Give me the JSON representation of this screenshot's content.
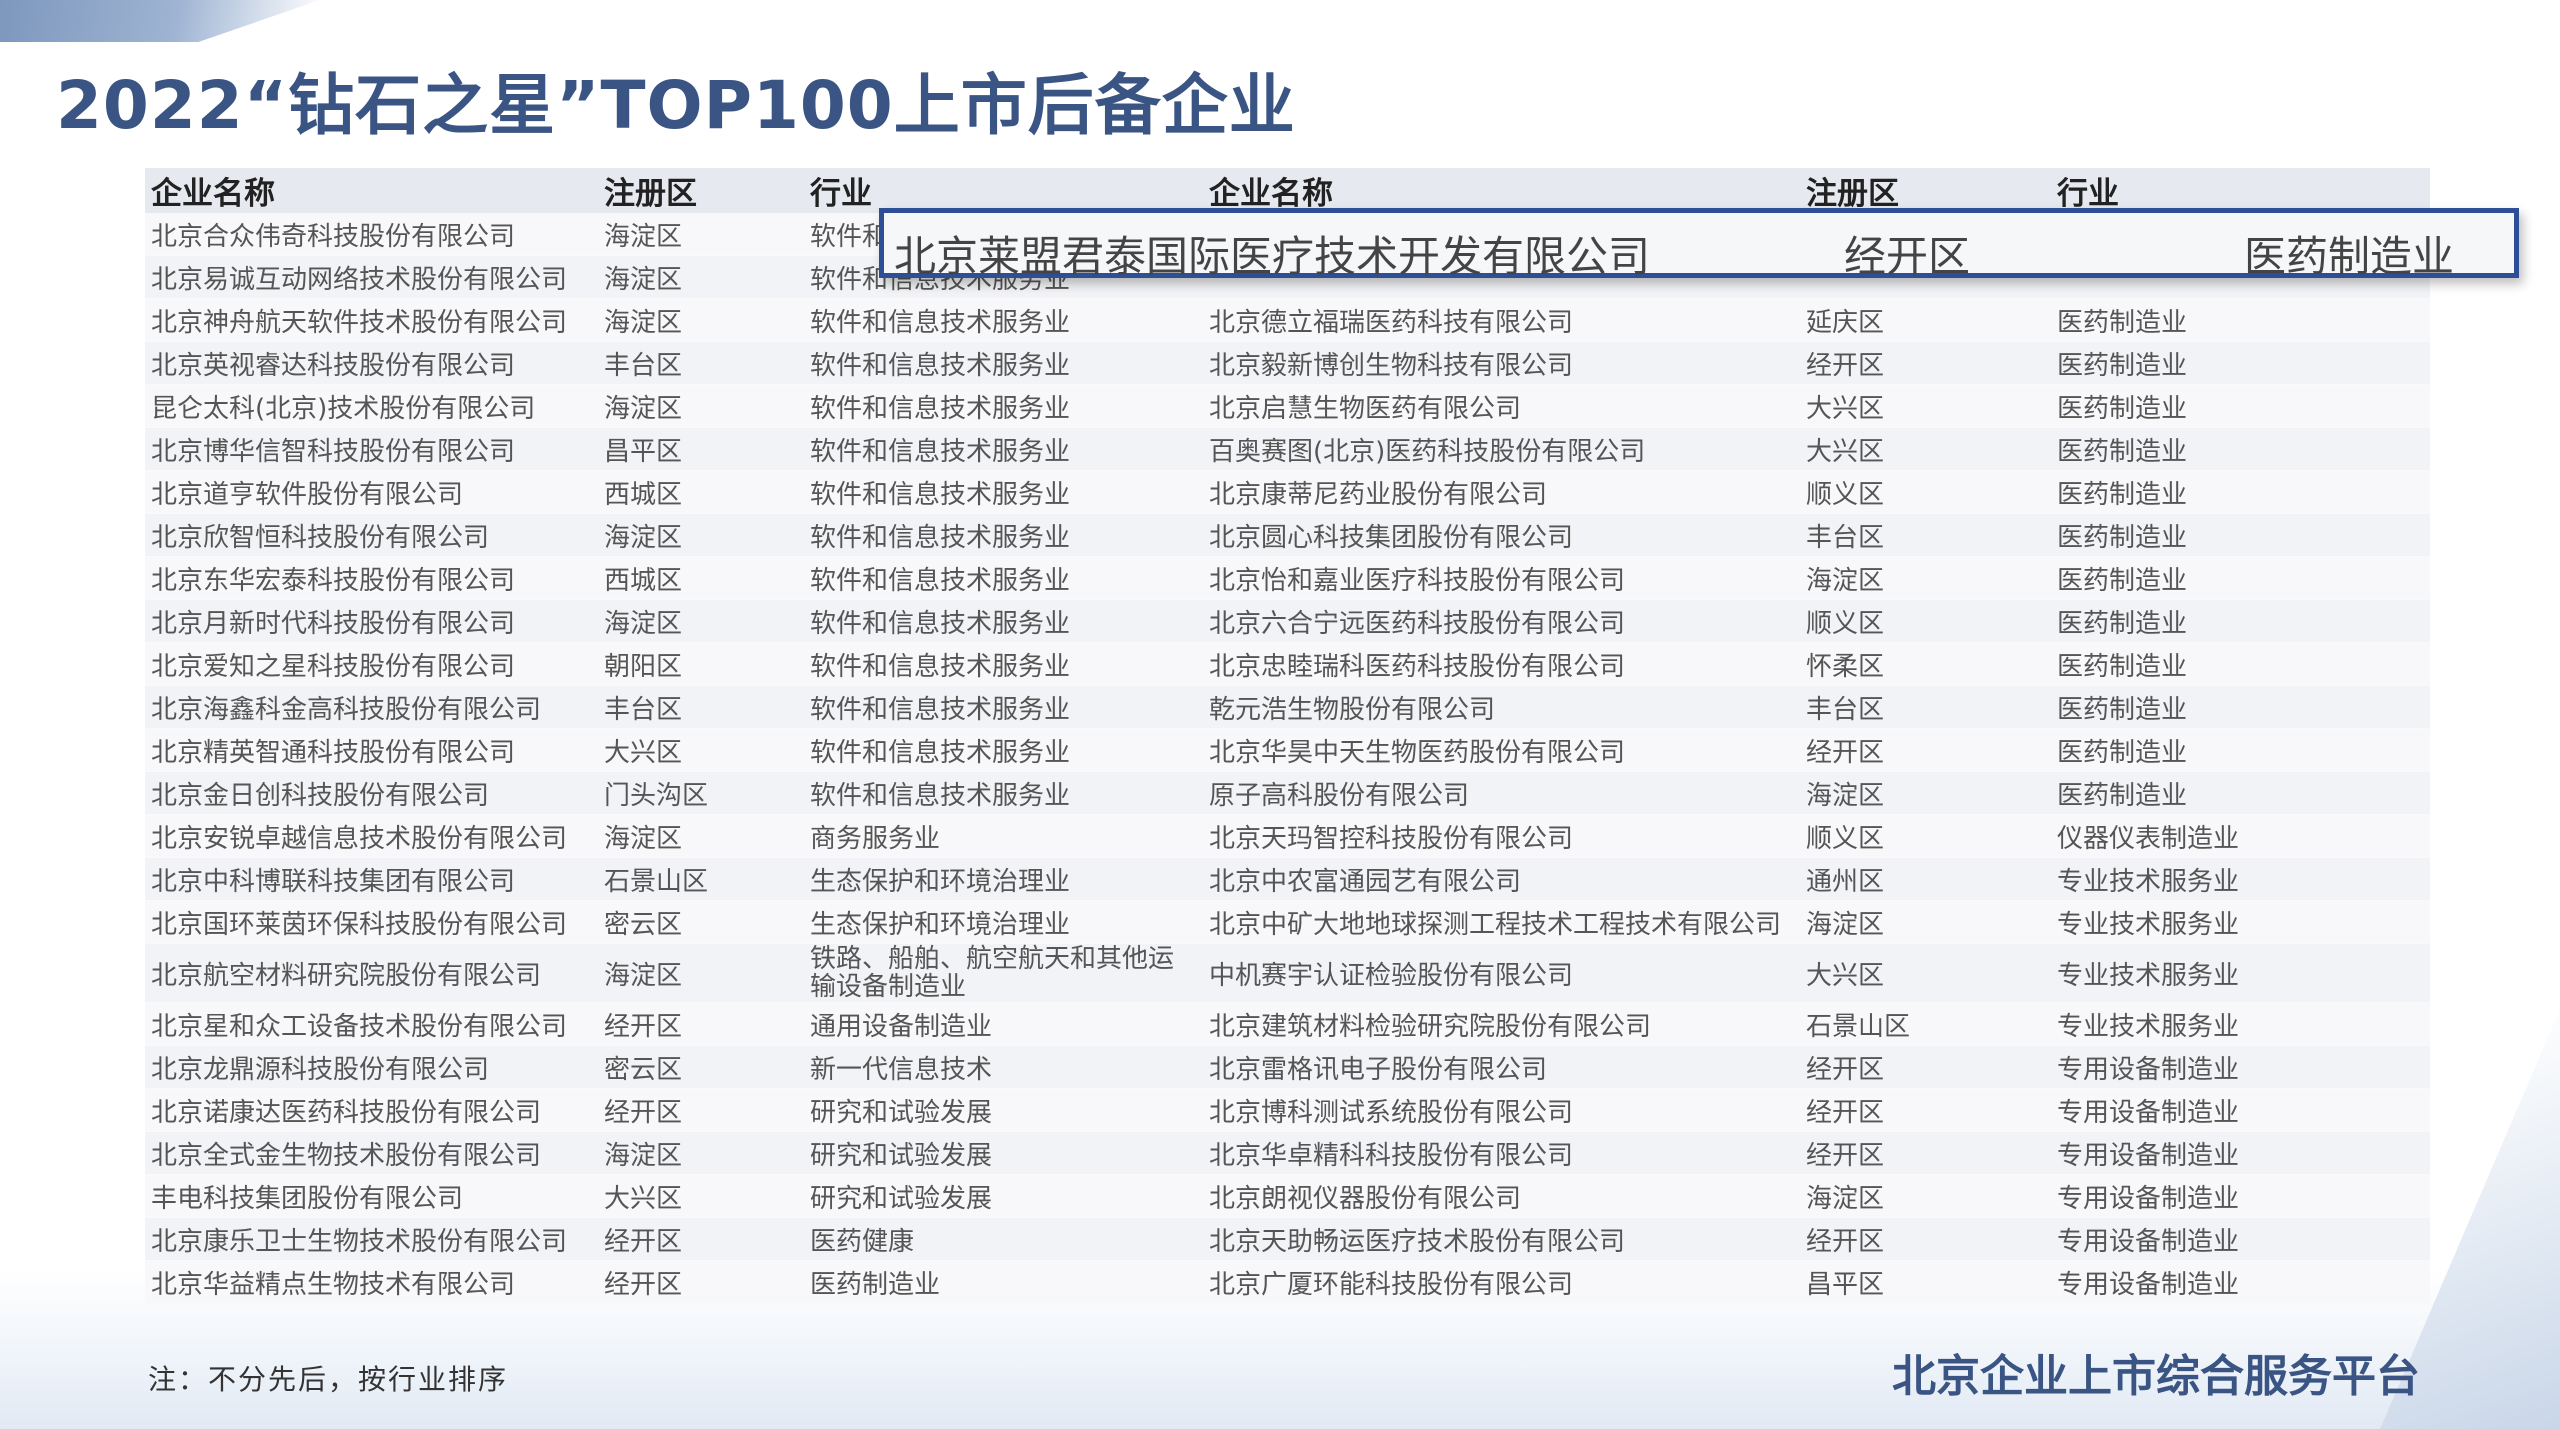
{
  "title": "2022“钻石之星”TOP100上市后备企业",
  "headers": [
    "企业名称",
    "注册区",
    "行业",
    "企业名称",
    "注册区",
    "行业"
  ],
  "highlight": {
    "name": "北京莱盟君泰国际医疗技术开发有限公司",
    "district": "经开区",
    "industry": "医药制造业"
  },
  "rows": [
    [
      "北京合众伟奇科技股份有限公司",
      "海淀区",
      "软件和信息技术服务业",
      "",
      "",
      ""
    ],
    [
      "北京易诚互动网络技术股份有限公司",
      "海淀区",
      "软件和信息技术服务业",
      "",
      "",
      ""
    ],
    [
      "北京神舟航天软件技术股份有限公司",
      "海淀区",
      "软件和信息技术服务业",
      "北京德立福瑞医药科技有限公司",
      "延庆区",
      "医药制造业"
    ],
    [
      "北京英视睿达科技股份有限公司",
      "丰台区",
      "软件和信息技术服务业",
      "北京毅新博创生物科技有限公司",
      "经开区",
      "医药制造业"
    ],
    [
      "昆仑太科(北京)技术股份有限公司",
      "海淀区",
      "软件和信息技术服务业",
      "北京启慧生物医药有限公司",
      "大兴区",
      "医药制造业"
    ],
    [
      "北京博华信智科技股份有限公司",
      "昌平区",
      "软件和信息技术服务业",
      "百奥赛图(北京)医药科技股份有限公司",
      "大兴区",
      "医药制造业"
    ],
    [
      "北京道亨软件股份有限公司",
      "西城区",
      "软件和信息技术服务业",
      "北京康蒂尼药业股份有限公司",
      "顺义区",
      "医药制造业"
    ],
    [
      "北京欣智恒科技股份有限公司",
      "海淀区",
      "软件和信息技术服务业",
      "北京圆心科技集团股份有限公司",
      "丰台区",
      "医药制造业"
    ],
    [
      "北京东华宏泰科技股份有限公司",
      "西城区",
      "软件和信息技术服务业",
      "北京怡和嘉业医疗科技股份有限公司",
      "海淀区",
      "医药制造业"
    ],
    [
      "北京月新时代科技股份有限公司",
      "海淀区",
      "软件和信息技术服务业",
      "北京六合宁远医药科技股份有限公司",
      "顺义区",
      "医药制造业"
    ],
    [
      "北京爱知之星科技股份有限公司",
      "朝阳区",
      "软件和信息技术服务业",
      "北京忠睦瑞科医药科技股份有限公司",
      "怀柔区",
      "医药制造业"
    ],
    [
      "北京海鑫科金高科技股份有限公司",
      "丰台区",
      "软件和信息技术服务业",
      "乾元浩生物股份有限公司",
      "丰台区",
      "医药制造业"
    ],
    [
      "北京精英智通科技股份有限公司",
      "大兴区",
      "软件和信息技术服务业",
      "北京华昊中天生物医药股份有限公司",
      "经开区",
      "医药制造业"
    ],
    [
      "北京金日创科技股份有限公司",
      "门头沟区",
      "软件和信息技术服务业",
      "原子高科股份有限公司",
      "海淀区",
      "医药制造业"
    ],
    [
      "北京安锐卓越信息技术股份有限公司",
      "海淀区",
      "商务服务业",
      "北京天玛智控科技股份有限公司",
      "顺义区",
      "仪器仪表制造业"
    ],
    [
      "北京中科博联科技集团有限公司",
      "石景山区",
      "生态保护和环境治理业",
      "北京中农富通园艺有限公司",
      "通州区",
      "专业技术服务业"
    ],
    [
      "北京国环莱茵环保科技股份有限公司",
      "密云区",
      "生态保护和环境治理业",
      "北京中矿大地地球探测工程技术工程技术有限公司",
      "海淀区",
      "专业技术服务业"
    ],
    [
      "北京航空材料研究院股份有限公司",
      "海淀区",
      "铁路、船舶、航空航天和其他运输设备制造业",
      "中机赛宇认证检验股份有限公司",
      "大兴区",
      "专业技术服务业"
    ],
    [
      "北京星和众工设备技术股份有限公司",
      "经开区",
      "通用设备制造业",
      "北京建筑材料检验研究院股份有限公司",
      "石景山区",
      "专业技术服务业"
    ],
    [
      "北京龙鼎源科技股份有限公司",
      "密云区",
      "新一代信息技术",
      "北京雷格讯电子股份有限公司",
      "经开区",
      "专用设备制造业"
    ],
    [
      "北京诺康达医药科技股份有限公司",
      "经开区",
      "研究和试验发展",
      "北京博科测试系统股份有限公司",
      "经开区",
      "专用设备制造业"
    ],
    [
      "北京全式金生物技术股份有限公司",
      "海淀区",
      "研究和试验发展",
      "北京华卓精科科技股份有限公司",
      "经开区",
      "专用设备制造业"
    ],
    [
      "丰电科技集团股份有限公司",
      "大兴区",
      "研究和试验发展",
      "北京朗视仪器股份有限公司",
      "海淀区",
      "专用设备制造业"
    ],
    [
      "北京康乐卫士生物技术股份有限公司",
      "经开区",
      "医药健康",
      "北京天助畅运医疗技术股份有限公司",
      "经开区",
      "专用设备制造业"
    ],
    [
      "北京华益精点生物技术有限公司",
      "经开区",
      "医药制造业",
      "北京广厦环能科技股份有限公司",
      "昌平区",
      "专用设备制造业"
    ]
  ],
  "note": "注：不分先后，按行业排序",
  "platform": "北京企业上市综合服务平台",
  "colors": {
    "title": "#3a5583",
    "highlight_border": "#2e4f95",
    "header_bg": "#e6e9ef"
  }
}
